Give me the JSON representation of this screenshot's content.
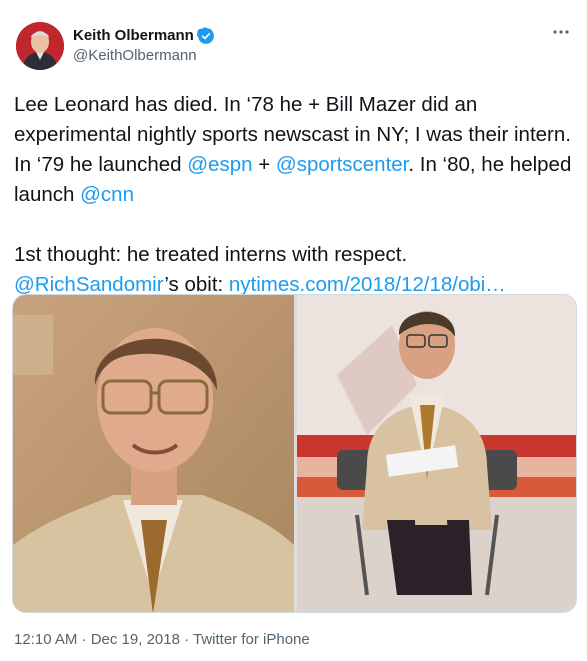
{
  "author": {
    "display_name": "Keith Olbermann",
    "handle": "@KeithOlbermann",
    "verified_icon": "verified-badge-icon",
    "more_icon": "more-options-icon"
  },
  "tweet": {
    "line1": "Lee Leonard has died. In ‘78 he + Bill Mazer did an experimental nightly sports newscast in NY; I was their intern. In ‘79 he launched ",
    "mention_espn": "@espn",
    "plus": " + ",
    "mention_sportscenter": "@sportscenter",
    "line2": ". In ‘80, he helped launch ",
    "mention_cnn": "@cnn",
    "para2_start": "1st thought: he treated interns with respect.",
    "mention_sandomir": "@RichSandomir",
    "obit_text": "’s obit: ",
    "link": "nytimes.com/2018/12/18/obi…"
  },
  "media": {
    "left_alt": "closeup-photo",
    "right_alt": "seated-studio-photo"
  },
  "meta": {
    "timestamp": "12:10 AM · Dec 19, 2018 · Twitter for iPhone"
  },
  "colors": {
    "link": "#1d9bf0",
    "secondary": "#536471",
    "text": "#0f1419"
  }
}
